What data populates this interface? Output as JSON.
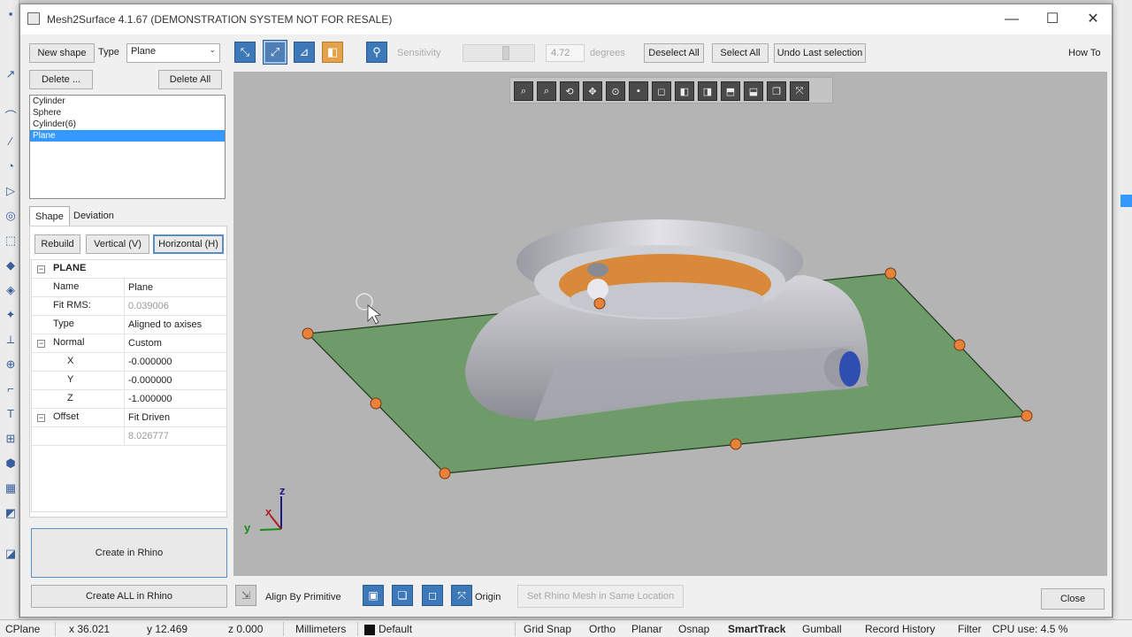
{
  "window": {
    "title": "Mesh2Surface 4.1.67 (DEMONSTRATION SYSTEM NOT FOR RESALE)",
    "minimize": "—",
    "maximize": "☐",
    "close": "✕"
  },
  "left_panel": {
    "new_shape": "New shape",
    "type_label": "Type",
    "type_value": "Plane",
    "delete": "Delete ...",
    "delete_all": "Delete All",
    "shapes": [
      {
        "label": "Cylinder",
        "selected": false
      },
      {
        "label": "Sphere",
        "selected": false
      },
      {
        "label": "Cylinder(6)",
        "selected": false
      },
      {
        "label": "Plane",
        "selected": true
      }
    ],
    "tabs": [
      {
        "label": "Shape",
        "active": true
      },
      {
        "label": "Deviation",
        "active": false
      }
    ],
    "rebuild": "Rebuild",
    "vertical": "Vertical (V)",
    "horizontal": "Horizontal (H)",
    "props": {
      "section": "PLANE",
      "name_key": "Name",
      "name_val": "Plane",
      "fit_key": "Fit RMS:",
      "fit_val": "0.039006",
      "type_key": "Type",
      "type_val": "Aligned to axises",
      "normal_key": "Normal",
      "normal_val": "Custom",
      "x_key": "X",
      "x_val": "-0.000000",
      "y_key": "Y",
      "y_val": "-0.000000",
      "z_key": "Z",
      "z_val": "-1.000000",
      "offset_key": "Offset",
      "offset_val": "Fit Driven",
      "offset_num": "8.026777"
    },
    "create_in_rhino": "Create in Rhino",
    "create_all": "Create ALL in Rhino"
  },
  "toolbar": {
    "sensitivity_label": "Sensitivity",
    "sensitivity_value": "4.72",
    "degrees_label": "degrees",
    "deselect_all": "Deselect All",
    "select_all": "Select All",
    "undo_last": "Undo Last selection",
    "how_to": "How To"
  },
  "viewport": {
    "axis_x": "x",
    "axis_y": "y",
    "axis_z": "z"
  },
  "bottom": {
    "align_by_primitive": "Align By Primitive",
    "origin": "Origin",
    "set_rhino_mesh": "Set Rhino Mesh in Same Location",
    "close": "Close"
  },
  "status_bar": {
    "cplane": "CPlane",
    "x": "x 36.021",
    "y": "y 12.469",
    "z": "z 0.000",
    "units": "Millimeters",
    "layer": "Default",
    "grid_snap": "Grid Snap",
    "ortho": "Ortho",
    "planar": "Planar",
    "osnap": "Osnap",
    "smarttrack": "SmartTrack",
    "gumball": "Gumball",
    "record_history": "Record History",
    "filter": "Filter",
    "cpu": "CPU use: 4.5 %"
  },
  "colors": {
    "accent": "#3399ff",
    "plane_fill": "#6f9a6a",
    "handle": "#e8823a",
    "inner_ring": "#d88a3a",
    "knob": "#2f4fb0"
  }
}
